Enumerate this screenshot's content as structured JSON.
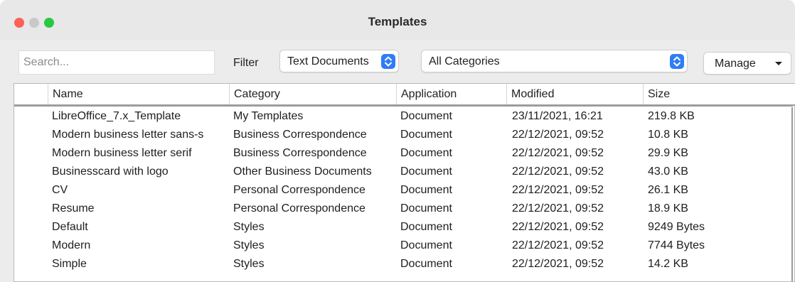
{
  "window": {
    "title": "Templates",
    "colors": {
      "close": "#fe5f57",
      "minimize": "#c9c9c9",
      "maximize": "#28c840",
      "accent": "#2f7df6"
    }
  },
  "toolbar": {
    "search_placeholder": "Search...",
    "filter_label": "Filter",
    "filter_value": "Text Documents",
    "category_value": "All Categories",
    "manage_label": "Manage"
  },
  "table": {
    "columns": [
      "Name",
      "Category",
      "Application",
      "Modified",
      "Size"
    ],
    "rows": [
      {
        "name": "LibreOffice_7.x_Template",
        "category": "My Templates",
        "application": "Document",
        "modified": "23/11/2021, 16:21",
        "size": "219.8 KB"
      },
      {
        "name": "Modern business letter sans-s",
        "category": "Business Correspondence",
        "application": "Document",
        "modified": "22/12/2021, 09:52",
        "size": "10.8 KB"
      },
      {
        "name": "Modern business letter serif",
        "category": "Business Correspondence",
        "application": "Document",
        "modified": "22/12/2021, 09:52",
        "size": "29.9 KB"
      },
      {
        "name": "Businesscard with logo",
        "category": "Other Business Documents",
        "application": "Document",
        "modified": "22/12/2021, 09:52",
        "size": "43.0 KB"
      },
      {
        "name": "CV",
        "category": "Personal Correspondence",
        "application": "Document",
        "modified": "22/12/2021, 09:52",
        "size": "26.1 KB"
      },
      {
        "name": "Resume",
        "category": "Personal Correspondence",
        "application": "Document",
        "modified": "22/12/2021, 09:52",
        "size": "18.9 KB"
      },
      {
        "name": "Default",
        "category": "Styles",
        "application": "Document",
        "modified": "22/12/2021, 09:52",
        "size": "9249 Bytes"
      },
      {
        "name": "Modern",
        "category": "Styles",
        "application": "Document",
        "modified": "22/12/2021, 09:52",
        "size": "7744 Bytes"
      },
      {
        "name": "Simple",
        "category": "Styles",
        "application": "Document",
        "modified": "22/12/2021, 09:52",
        "size": "14.2 KB"
      }
    ]
  }
}
